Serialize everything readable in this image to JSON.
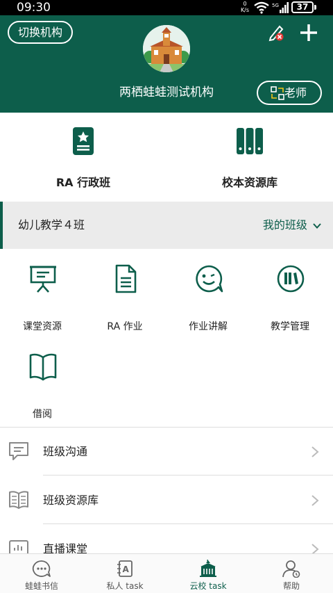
{
  "status_bar": {
    "time": "09:30",
    "speed_value": "0",
    "speed_unit": "K/s",
    "battery": "37"
  },
  "header": {
    "switch_label": "切换机构",
    "org_name": "两栖蛙蛙测试机构",
    "role_label": "老师"
  },
  "top_cards": [
    {
      "label": "RA 行政班",
      "icon": "admin-class-icon"
    },
    {
      "label": "校本资源库",
      "icon": "books-icon"
    }
  ],
  "class_bar": {
    "class_name": "幼儿教学４班",
    "my_class_label": "我的班级"
  },
  "features": [
    {
      "label": "课堂资源",
      "icon": "presentation-board-icon"
    },
    {
      "label": "RA 作业",
      "icon": "document-icon"
    },
    {
      "label": "作业讲解",
      "icon": "chat-smile-icon"
    },
    {
      "label": "教学管理",
      "icon": "bookshelf-icon"
    },
    {
      "label": "借阅",
      "icon": "open-book-icon"
    }
  ],
  "list": [
    {
      "label": "班级沟通",
      "icon": "message-icon"
    },
    {
      "label": "班级资源库",
      "icon": "reader-icon"
    },
    {
      "label": "直播课堂",
      "icon": "live-chart-icon"
    }
  ],
  "bottom_nav": [
    {
      "label": "蛙蛙书信",
      "icon": "letter-chat-icon",
      "active": false
    },
    {
      "label": "私人 task",
      "icon": "notebook-a-icon",
      "active": false
    },
    {
      "label": "云校 task",
      "icon": "school-building-icon",
      "active": true
    },
    {
      "label": "帮助",
      "icon": "help-person-icon",
      "active": false
    }
  ],
  "colors": {
    "brand": "#0d5e4b",
    "header_bg": "#0d5e4b",
    "class_bar_bg": "#ebebeb"
  }
}
